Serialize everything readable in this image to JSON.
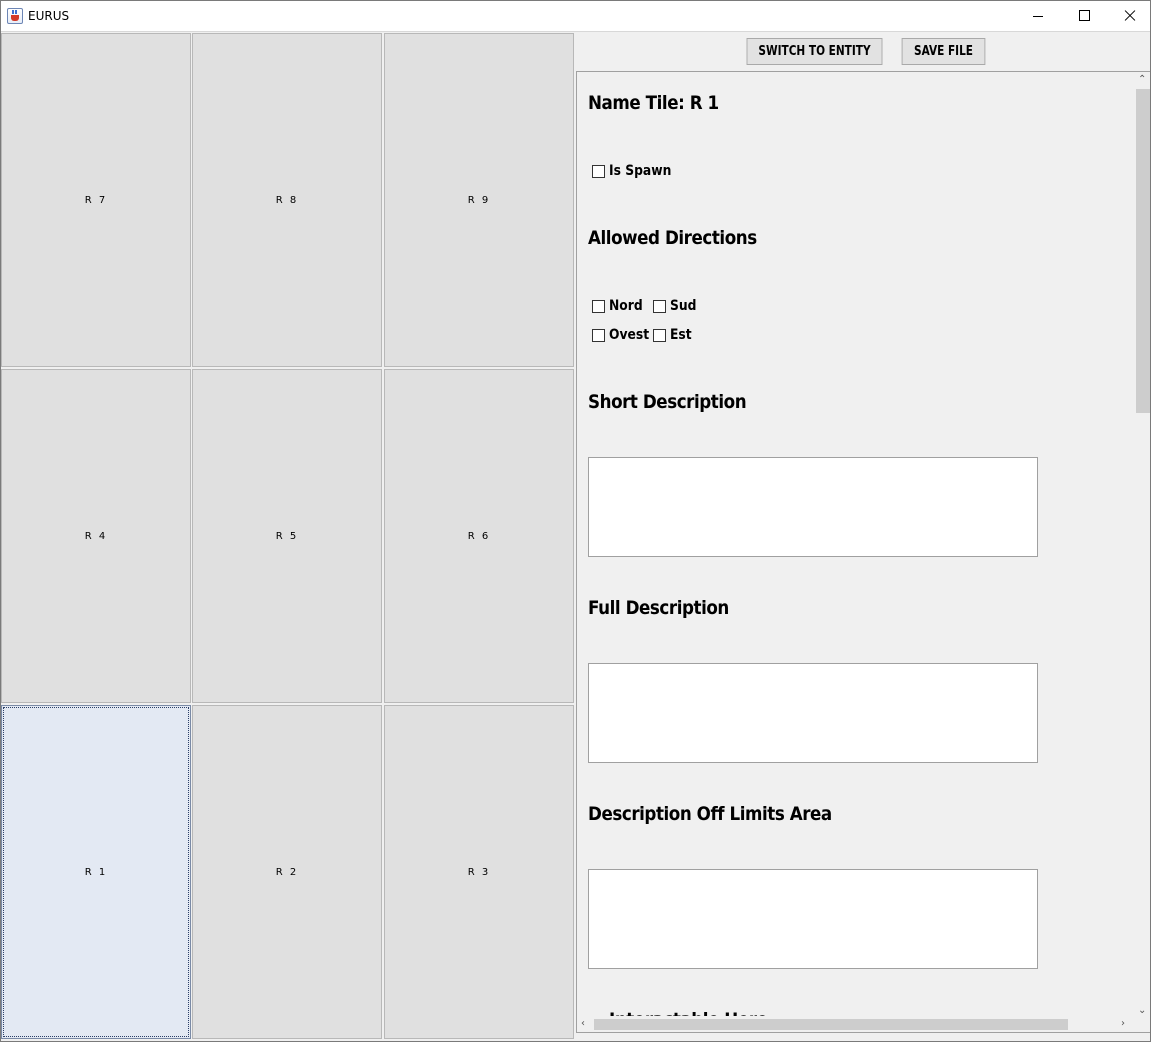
{
  "window": {
    "title": "EURUS"
  },
  "grid": {
    "tiles": [
      "R 7",
      "R 8",
      "R 9",
      "R 4",
      "R 5",
      "R 6",
      "R 1",
      "R 2",
      "R 3"
    ],
    "selected": "R 1"
  },
  "toolbar": {
    "switch_label": "SWITCH TO ENTITY",
    "save_label": "SAVE FILE"
  },
  "editor": {
    "name_tile": "Name Tile: R 1",
    "is_spawn_label": "Is Spawn",
    "allowed_directions_title": "Allowed Directions",
    "directions": {
      "nord": "Nord",
      "sud": "Sud",
      "ovest": "Ovest",
      "est": "Est"
    },
    "short_description_title": "Short Description",
    "full_description_title": "Full Description",
    "off_limits_title": "Description Off Limits Area",
    "interactable_title": "Interactable Here"
  }
}
